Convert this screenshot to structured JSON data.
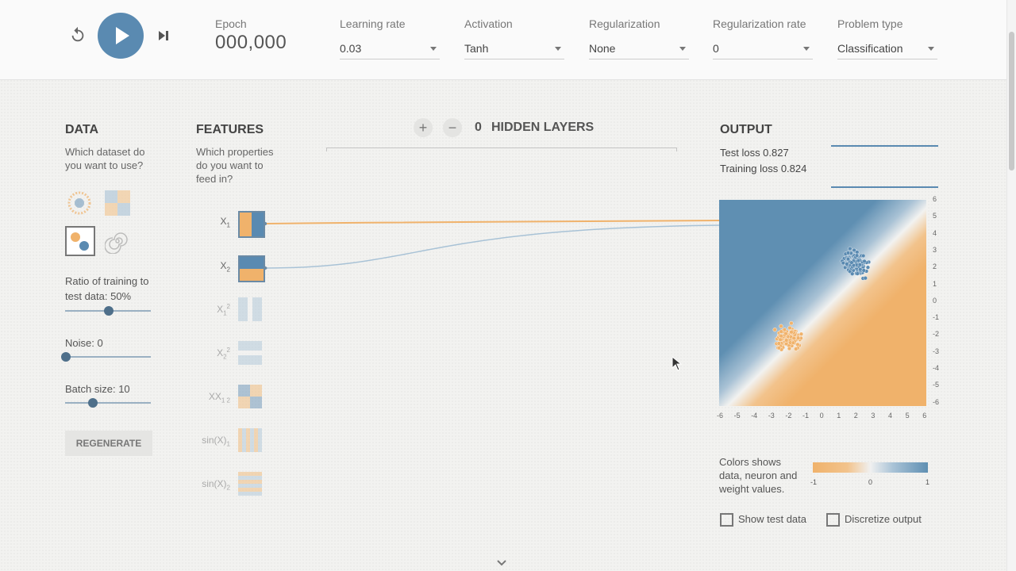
{
  "controls": {
    "epoch_label": "Epoch",
    "epoch_value": "000,000"
  },
  "selects": [
    {
      "label": "Learning rate",
      "value": "0.03"
    },
    {
      "label": "Activation",
      "value": "Tanh"
    },
    {
      "label": "Regularization",
      "value": "None"
    },
    {
      "label": "Regularization rate",
      "value": "0"
    },
    {
      "label": "Problem type",
      "value": "Classification"
    }
  ],
  "data_panel": {
    "title": "DATA",
    "subtitle_line1": "Which dataset do",
    "subtitle_line2": "you want to use?",
    "ratio_label_line1": "Ratio of training to",
    "ratio_label_line2": "test data:  50%",
    "ratio_value": 50,
    "noise_label": "Noise:  0",
    "noise_value": 0,
    "batch_label": "Batch size:  10",
    "batch_value": 10,
    "regenerate": "REGENERATE"
  },
  "features": {
    "title": "FEATURES",
    "sub1": "Which properties",
    "sub2": "do you want to",
    "sub3": "feed in?",
    "items": [
      "X",
      "X",
      "X",
      "X",
      "XX",
      "sin(X)",
      "sin(X)"
    ],
    "subscripts": [
      "1",
      "2",
      "1",
      "2",
      "1 2",
      "1",
      "2"
    ],
    "superscripts": [
      "",
      "",
      "2",
      "2",
      "",
      "",
      ""
    ]
  },
  "hidden": {
    "count": "0",
    "title": "HIDDEN LAYERS",
    "add": "+",
    "remove": "−"
  },
  "output": {
    "title": "OUTPUT",
    "test_loss": "Test loss 0.827",
    "training_loss": "Training loss 0.824",
    "legend_line1": "Colors shows",
    "legend_line2": "data, neuron and",
    "legend_line3": "weight values.",
    "grad_min": "-1",
    "grad_mid": "0",
    "grad_max": "1",
    "show_test": "Show test data",
    "discretize": "Discretize output"
  },
  "axes": {
    "x_ticks": [
      "-6",
      "-5",
      "-4",
      "-3",
      "-2",
      "-1",
      "0",
      "1",
      "2",
      "3",
      "4",
      "5",
      "6"
    ],
    "y_ticks": [
      "6",
      "5",
      "4",
      "3",
      "2",
      "1",
      "0",
      "-1",
      "-2",
      "-3",
      "-4",
      "-5",
      "-6"
    ]
  },
  "colors": {
    "blue": "#5a8ab1",
    "orange": "#f0b26b"
  },
  "icons": {
    "reset": "reset-icon",
    "play": "play-icon",
    "step": "step-forward-icon",
    "chevron": "chevron-down-icon"
  }
}
